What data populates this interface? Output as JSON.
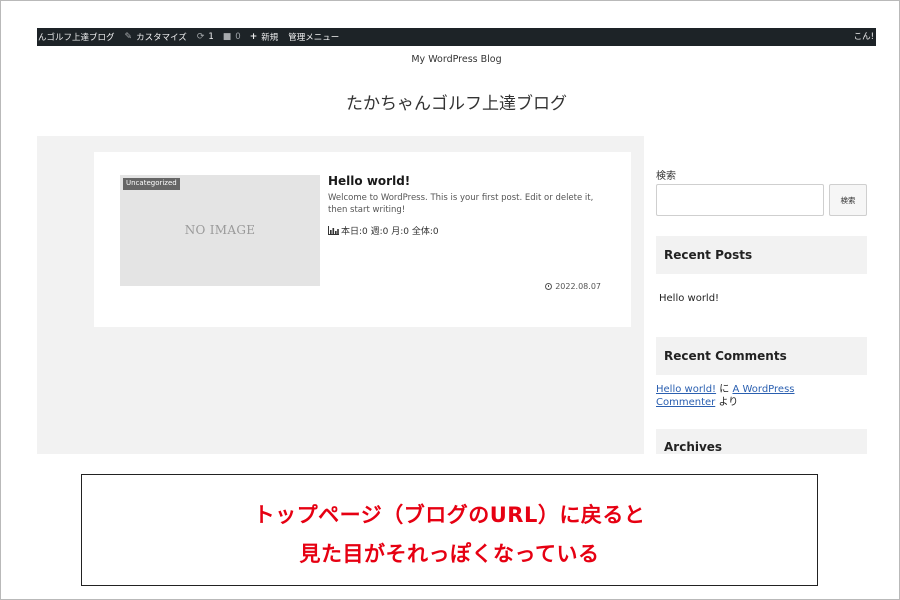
{
  "admin_bar": {
    "site_name": "んゴルフ上達ブログ",
    "customize": "カスタマイズ",
    "updates_count": "1",
    "comments_count": "0",
    "new_label": "新規",
    "admin_menu": "管理メニュー",
    "greeting": "こん!"
  },
  "header": {
    "tagline": "My WordPress Blog",
    "site_title": "たかちゃんゴルフ上達ブログ"
  },
  "post": {
    "category": "Uncategorized",
    "thumbnail_text": "NO IMAGE",
    "title": "Hello world!",
    "excerpt": "Welcome to WordPress. This is your first post. Edit or delete it, then start writing!",
    "stats": "本日:0  週:0  月:0  全体:0",
    "date": "2022.08.07"
  },
  "sidebar": {
    "search_label": "検索",
    "search_placeholder": "",
    "search_button": "検索",
    "recent_posts_title": "Recent Posts",
    "recent_posts": [
      "Hello world!"
    ],
    "recent_comments_title": "Recent Comments",
    "comment_post_link": "Hello world!",
    "comment_ni": "に",
    "comment_author": "A WordPress Commenter",
    "comment_yori": "より",
    "archives_title": "Archives"
  },
  "caption": {
    "line1": "トップページ（ブログのURL）に戻ると",
    "line2": "見た目がそれっぽくなっている",
    "color": "#e60012"
  }
}
